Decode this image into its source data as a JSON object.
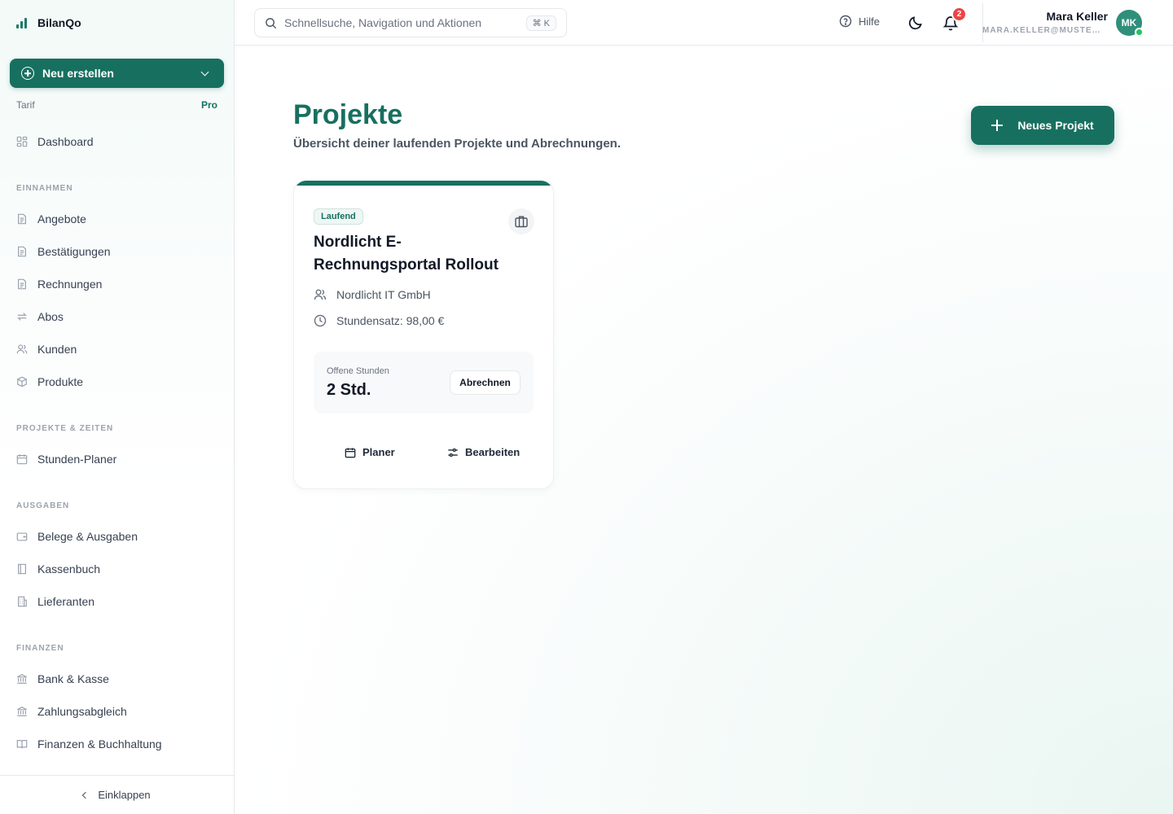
{
  "brand": {
    "name": "BilanQo"
  },
  "sidebar": {
    "create_label": "Neu erstellen",
    "tarif_label": "Tarif",
    "tarif_value": "Pro",
    "dashboard": "Dashboard",
    "sections": {
      "income": "EINNAHMEN",
      "projects": "PROJEKTE & ZEITEN",
      "expenses": "AUSGABEN",
      "finance": "FINANZEN"
    },
    "items": {
      "offers": "Angebote",
      "confirmations": "Bestätigungen",
      "invoices": "Rechnungen",
      "subscriptions": "Abos",
      "customers": "Kunden",
      "products": "Produkte",
      "hours_planner": "Stunden-Planer",
      "receipts": "Belege & Ausgaben",
      "cashbook": "Kassenbuch",
      "suppliers": "Lieferanten",
      "bank": "Bank & Kasse",
      "payment_matching": "Zahlungsabgleich",
      "finance_accounting": "Finanzen & Buchhaltung"
    },
    "collapse": "Einklappen"
  },
  "topbar": {
    "search_placeholder": "Schnellsuche, Navigation und Aktionen",
    "search_shortcut": "⌘ K",
    "help": "Hilfe",
    "notification_count": "2",
    "user_name": "Mara Keller",
    "user_email": "MARA.KELLER@MUSTERFIRMA.DE",
    "user_initials": "MK"
  },
  "main": {
    "title": "Projekte",
    "subtitle": "Übersicht deiner laufenden Projekte und Abrechnungen.",
    "new_project": "Neues Projekt"
  },
  "project_card": {
    "status": "Laufend",
    "title": "Nordlicht E-Rechnungsportal Rollout",
    "client": "Nordlicht IT GmbH",
    "rate": "Stundensatz: 98,00 €",
    "open_label": "Offene Stunden",
    "open_value": "2 Std.",
    "bill_button": "Abrechnen",
    "planner": "Planer",
    "edit": "Bearbeiten"
  },
  "colors": {
    "accent": "#17705f",
    "badge": "#ef4444",
    "online": "#22c55e"
  }
}
